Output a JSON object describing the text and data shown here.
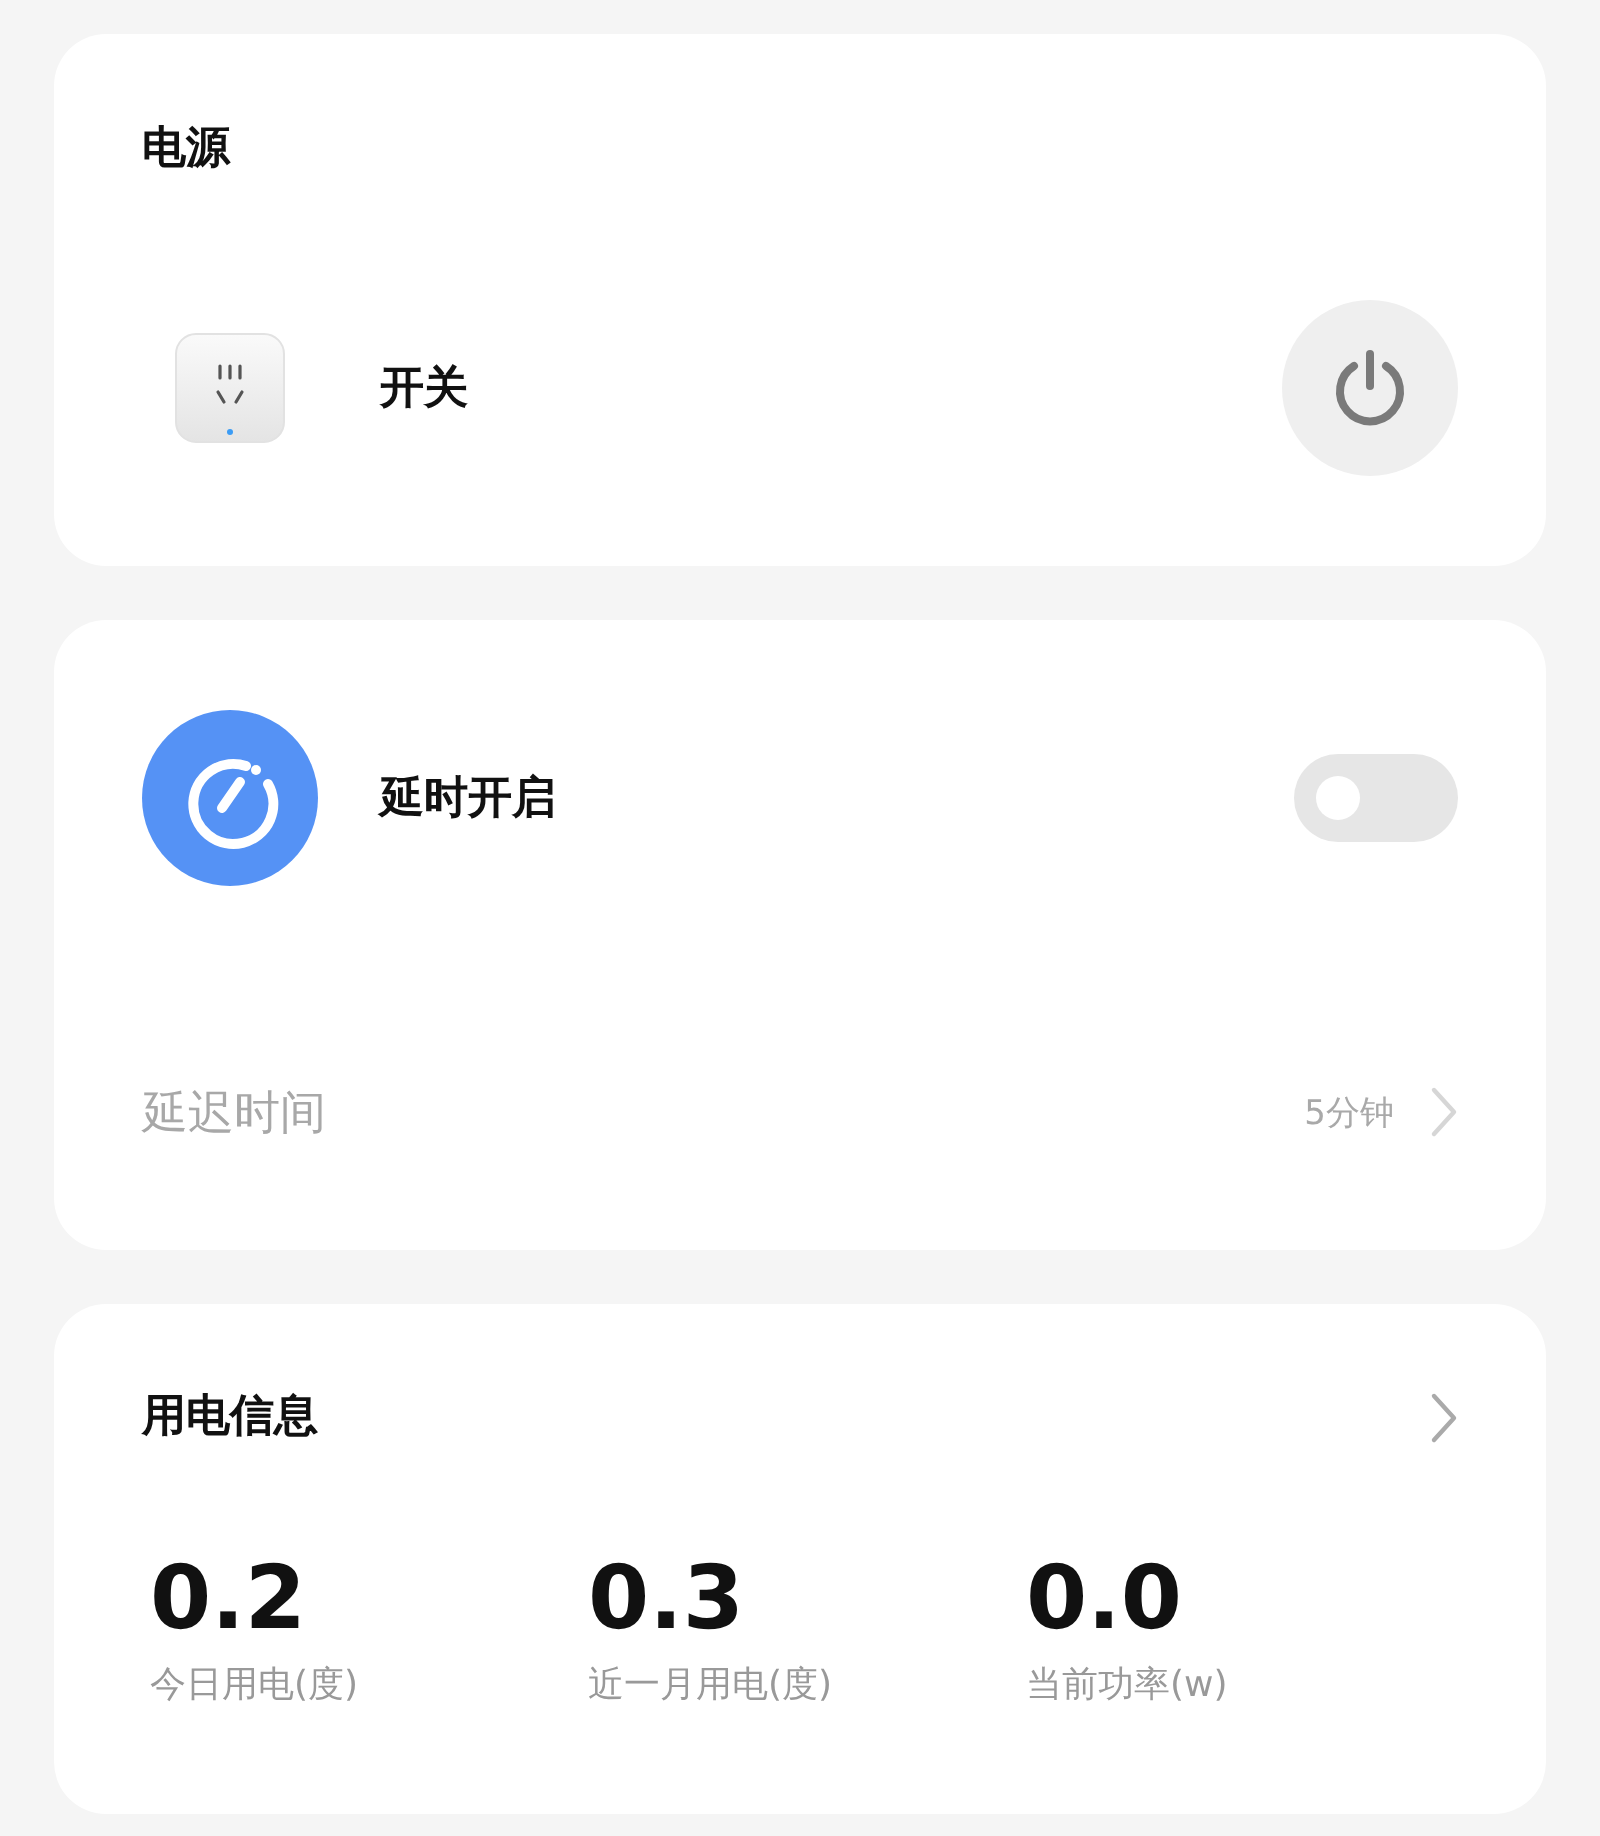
{
  "power_card": {
    "title": "电源",
    "switch_label": "开关",
    "on": false
  },
  "delay_card": {
    "label": "延时开启",
    "enabled": false,
    "delay_row": {
      "label": "延迟时间",
      "value": "5分钟",
      "disabled": true
    }
  },
  "usage_card": {
    "title": "用电信息",
    "stats": [
      {
        "value": "0.2",
        "label": "今日用电(度)"
      },
      {
        "value": "0.3",
        "label": "近一月用电(度)"
      },
      {
        "value": "0.0",
        "label": "当前功率(w)"
      }
    ]
  }
}
